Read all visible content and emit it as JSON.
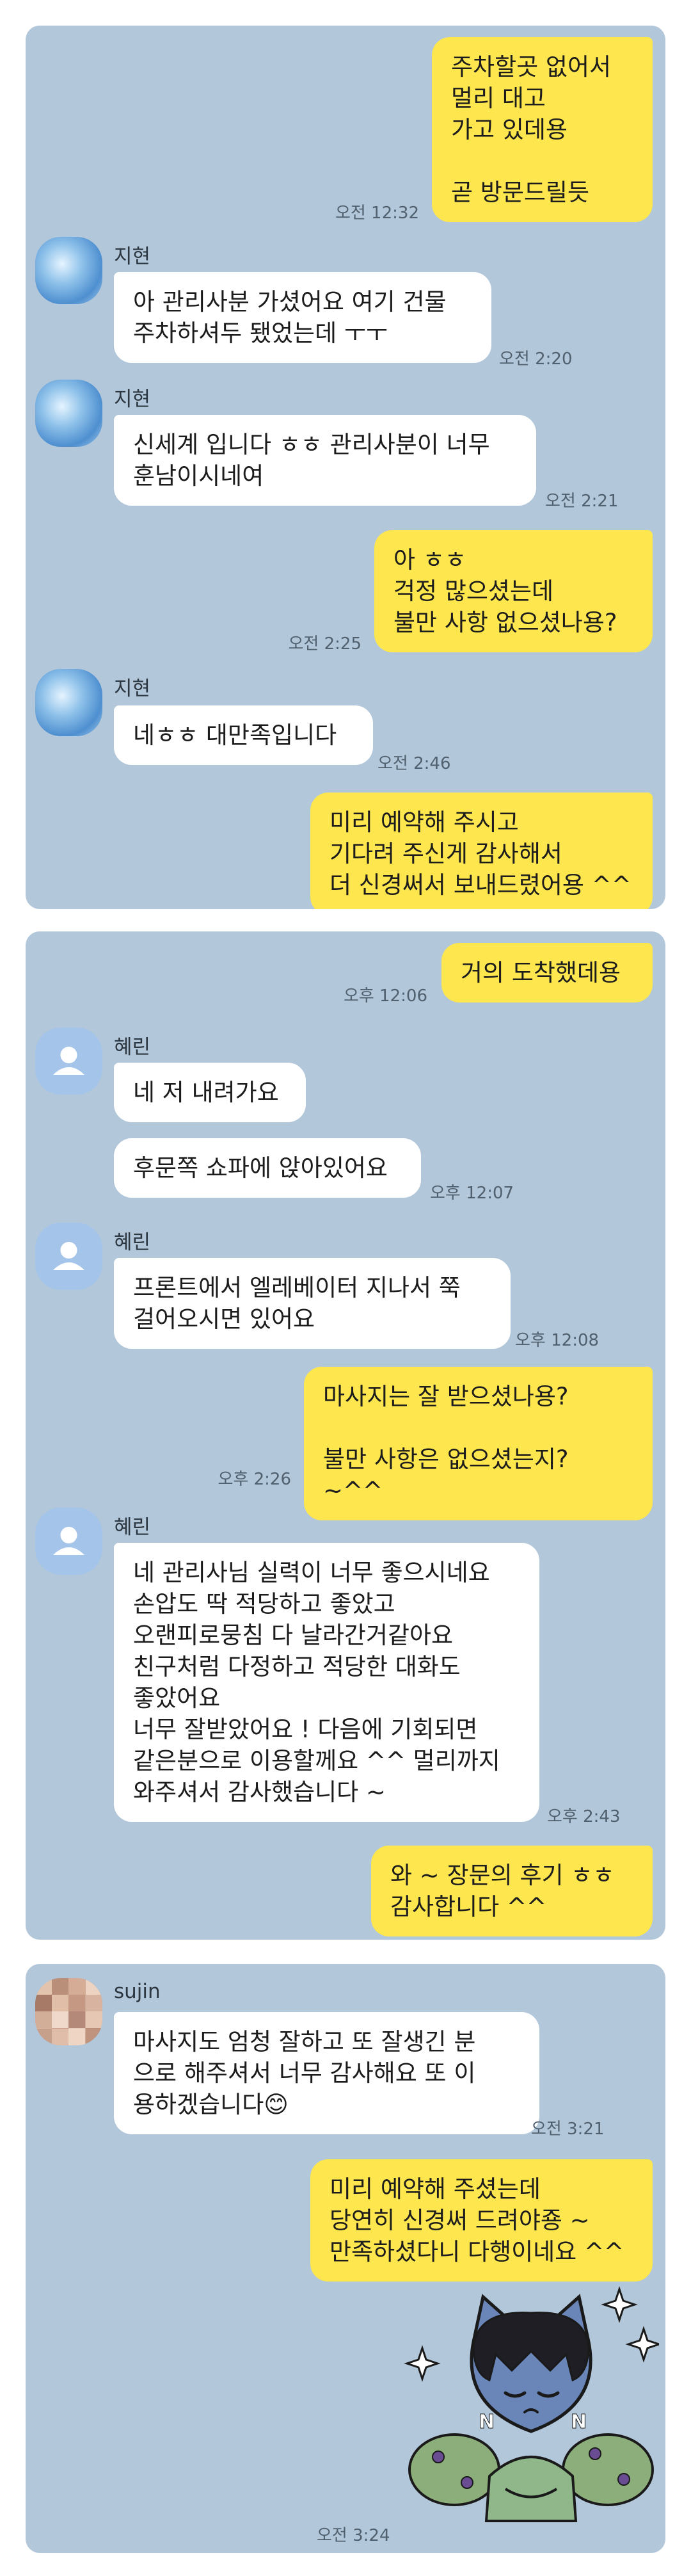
{
  "panel1": {
    "msg1": {
      "text": "주차할곳 없어서\n멀리 대고\n가고 있데용\n\n곧 방문드릴듯",
      "time": "오전 12:32"
    },
    "msg2": {
      "sender": "지현",
      "text": "아 관리사분 가셨어요 여기 건물\n주차하셔두 됐었는데 ㅜㅜ",
      "time": "오전 2:20"
    },
    "msg3": {
      "sender": "지현",
      "text": "신세계 입니다 ㅎㅎ 관리사분이 너무\n훈남이시네여",
      "time": "오전 2:21"
    },
    "msg4": {
      "text": "아 ㅎㅎ\n걱정 많으셨는데\n불만 사항 없으셨나용?",
      "time": "오전 2:25"
    },
    "msg5": {
      "sender": "지현",
      "text": "네ㅎㅎ 대만족입니다",
      "time": "오전 2:46"
    },
    "msg6": {
      "text": "미리 예약해 주시고\n기다려 주신게 감사해서\n더 신경써서 보내드렸어용 ^^"
    }
  },
  "panel2": {
    "msg1": {
      "text": "거의 도착했데용",
      "time": "오후 12:06"
    },
    "msg2": {
      "sender": "혜린",
      "text": "네 저 내려가요"
    },
    "msg3": {
      "text": "후문쪽 쇼파에 앉아있어요",
      "time": "오후 12:07"
    },
    "msg4": {
      "sender": "혜린",
      "text": "프론트에서 엘레베이터 지나서 쭉\n걸어오시면 있어요",
      "time": "오후 12:08"
    },
    "msg5": {
      "text": "마사지는 잘 받으셨나용?\n\n불만 사항은 없으셨는지? ~^^",
      "time": "오후 2:26"
    },
    "msg6": {
      "sender": "혜린",
      "text": "네 관리사님 실력이 너무 좋으시네요\n손압도 딱 적당하고 좋았고\n오랜피로뭉침 다 날라간거같아요\n친구처럼 다정하고 적당한 대화도\n좋았어요\n너무 잘받았어요 ! 다음에 기회되면\n같은분으로 이용할께요 ^^ 멀리까지\n와주셔서 감사했습니다 ~",
      "time": "오후 2:43"
    },
    "msg7": {
      "text": "와 ~ 장문의 후기 ㅎㅎ\n감사합니다 ^^"
    }
  },
  "panel3": {
    "msg1": {
      "sender": "sujin",
      "text": "마사지도 엄청 잘하고 또 잘생긴 분\n으로 해주셔서 너무 감사해요 또 이\n용하겠습니다😊",
      "time": "오전 3:21"
    },
    "msg2": {
      "text": "미리 예약해 주셨는데\n당연히 신경써 드려야죵 ~\n만족하셨다니 다행이네요 ^^"
    },
    "sticker": {
      "icon": "cat-character-sticker-icon",
      "time": "오전 3:24"
    }
  },
  "colors": {
    "chat_background": "#b2c7da",
    "outgoing_bubble": "#fee64e",
    "incoming_bubble": "#ffffff"
  }
}
